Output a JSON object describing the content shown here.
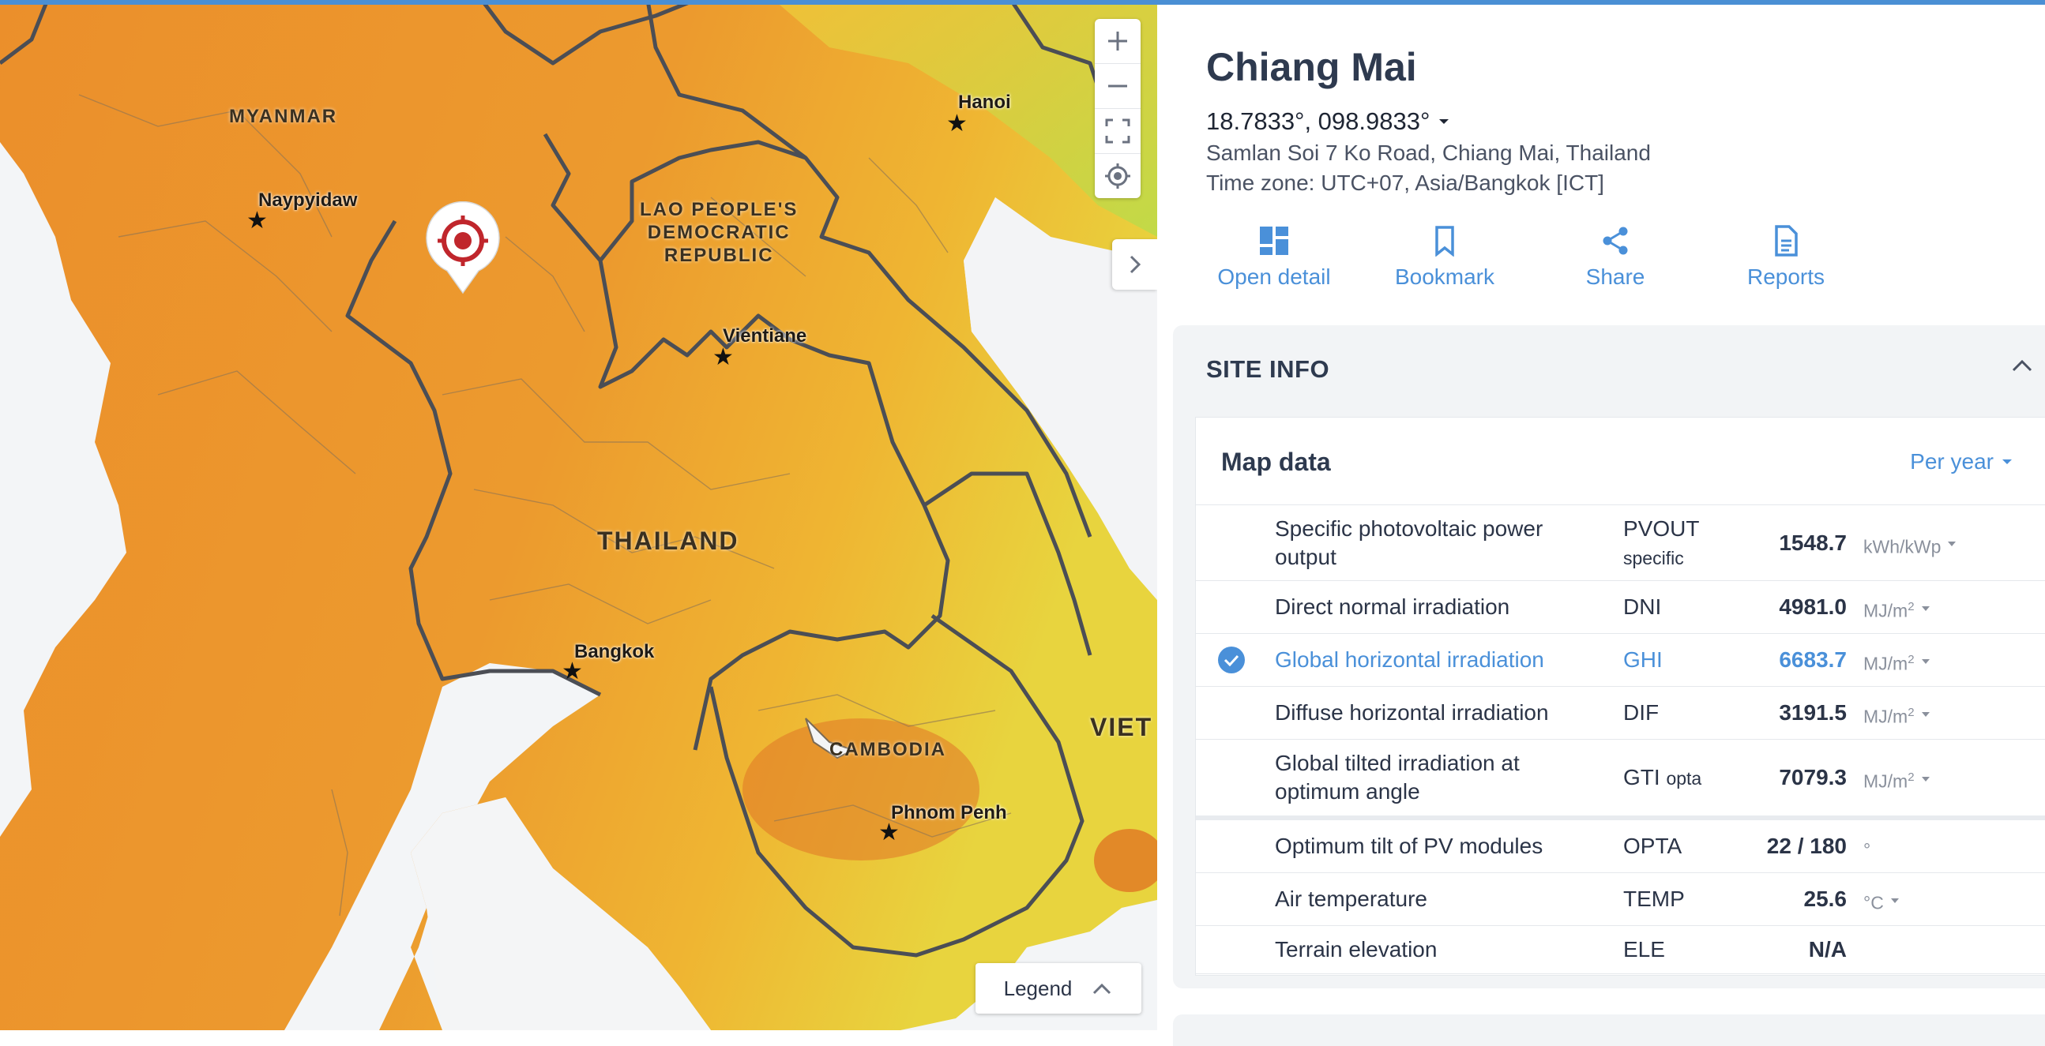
{
  "map": {
    "labels": {
      "myanmar": "MYANMAR",
      "laos": "LAO PEOPLE'S\nDEMOCRATIC\nREPUBLIC",
      "thailand": "THAILAND",
      "cambodia": "CAMBODIA",
      "viet": "VIET"
    },
    "cities": {
      "hanoi": "Hanoi",
      "naypyidaw": "Naypyidaw",
      "vientiane": "Vientiane",
      "bangkok": "Bangkok",
      "phnom_penh": "Phnom Penh"
    },
    "legend_label": "Legend",
    "icons": [
      "zoom-in-icon",
      "zoom-out-icon",
      "fullscreen-icon",
      "locate-icon",
      "chevron-right-icon",
      "chevron-up-icon",
      "location-pin-icon"
    ]
  },
  "site": {
    "name": "Chiang Mai",
    "coordinates": "18.7833°, 098.9833°",
    "address": "Samlan Soi 7 Ko Road, Chiang Mai, Thailand",
    "timezone": "Time zone: UTC+07, Asia/Bangkok [ICT]"
  },
  "actions": [
    {
      "label": "Open detail",
      "icon": "dashboard-icon"
    },
    {
      "label": "Bookmark",
      "icon": "bookmark-icon"
    },
    {
      "label": "Share",
      "icon": "share-icon"
    },
    {
      "label": "Reports",
      "icon": "report-icon"
    }
  ],
  "site_info": {
    "heading": "SITE INFO",
    "card_title": "Map data",
    "period": "Per year",
    "rows": [
      {
        "name": "Specific photovoltaic power output",
        "abbr": "PVOUT",
        "abbr_sub": "specific",
        "value": "1548.7",
        "unit": "kWh/kWp",
        "unit_sup": "",
        "selected": false
      },
      {
        "name": "Direct normal irradiation",
        "abbr": "DNI",
        "abbr_sub": "",
        "value": "4981.0",
        "unit": "MJ/m",
        "unit_sup": "2",
        "selected": false
      },
      {
        "name": "Global horizontal irradiation",
        "abbr": "GHI",
        "abbr_sub": "",
        "value": "6683.7",
        "unit": "MJ/m",
        "unit_sup": "2",
        "selected": true
      },
      {
        "name": "Diffuse horizontal irradiation",
        "abbr": "DIF",
        "abbr_sub": "",
        "value": "3191.5",
        "unit": "MJ/m",
        "unit_sup": "2",
        "selected": false
      },
      {
        "name": "Global tilted irradiation at optimum angle",
        "abbr": "GTI",
        "abbr_sub": "opta",
        "value": "7079.3",
        "unit": "MJ/m",
        "unit_sup": "2",
        "selected": false
      },
      {
        "name": "Optimum tilt of PV modules",
        "abbr": "OPTA",
        "abbr_sub": "",
        "value": "22 /  180",
        "unit": "°",
        "unit_sup": "",
        "selected": false
      },
      {
        "name": "Air temperature",
        "abbr": "TEMP",
        "abbr_sub": "",
        "value": "25.6",
        "unit": "°C",
        "unit_sup": "",
        "selected": false
      },
      {
        "name": "Terrain elevation",
        "abbr": "ELE",
        "abbr_sub": "",
        "value": "N/A",
        "unit": "",
        "unit_sup": "",
        "selected": false
      }
    ]
  },
  "colors": {
    "accent": "#4a90d9",
    "pin": "#c0262c",
    "heat_high": "#e8862c",
    "heat_low": "#f2d23a"
  }
}
